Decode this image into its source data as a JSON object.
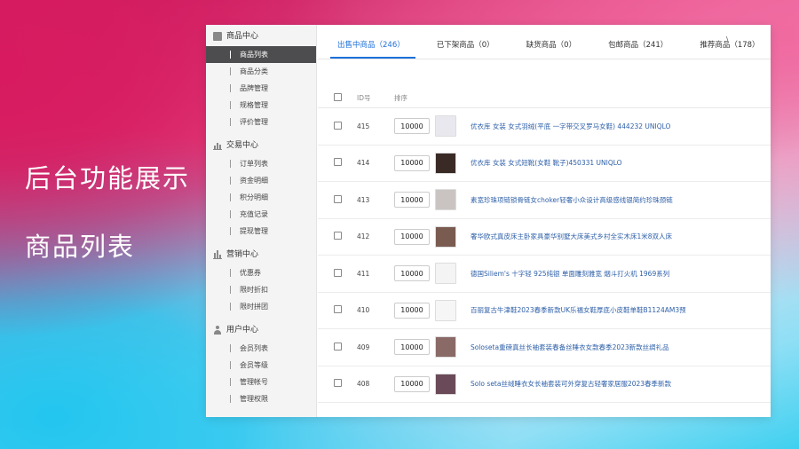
{
  "left_titles": [
    "后台功能展示",
    "商品列表"
  ],
  "sidebar": {
    "groups": [
      {
        "title": "商品中心",
        "icon": "box-icon",
        "items": [
          "商品列表",
          "商品分类",
          "品牌管理",
          "规格管理",
          "评价管理"
        ]
      },
      {
        "title": "交易中心",
        "icon": "bar-chart-icon",
        "items": [
          "订单列表",
          "资金明细",
          "积分明细",
          "充值记录",
          "提现管理"
        ]
      },
      {
        "title": "营销中心",
        "icon": "chart-icon",
        "items": [
          "优惠券",
          "限时折扣",
          "限时拼团"
        ]
      },
      {
        "title": "用户中心",
        "icon": "user-icon",
        "items": [
          "会员列表",
          "会员等级",
          "管理帐号",
          "管理权限"
        ]
      }
    ],
    "active_item": "商品列表"
  },
  "tabs": [
    {
      "label": "出售中商品（246）",
      "active": true
    },
    {
      "label": "已下架商品（0）",
      "active": false
    },
    {
      "label": "缺货商品（0）",
      "active": false
    },
    {
      "label": "包邮商品（241）",
      "active": false
    },
    {
      "label": "推荐商品（178）",
      "active": false
    }
  ],
  "table": {
    "headers": {
      "id": "ID号",
      "sort": "排序"
    },
    "rows": [
      {
        "id": "415",
        "sort": "10000",
        "name": "优衣库 女装 女式羽绒(平底 一字带交叉罗马女鞋) 444232 UNIQLO",
        "thumb_color": "#e8e8ee"
      },
      {
        "id": "414",
        "sort": "10000",
        "name": "优衣库 女装 女式短靴(女鞋 靴子)450331 UNIQLO",
        "thumb_color": "#3a2a26"
      },
      {
        "id": "413",
        "sort": "10000",
        "name": "素宽珍珠项链锁骨链女choker轻奢小众设计高级感线银简约珍珠颈链",
        "thumb_color": "#c9c4c2"
      },
      {
        "id": "412",
        "sort": "10000",
        "name": "奢华欧式真皮床主卧家具豪华别墅大床美式乡村全实木床1米8双人床",
        "thumb_color": "#7a5b50"
      },
      {
        "id": "411",
        "sort": "10000",
        "name": "德国Siliem's 十字轻 925纯银 单面雕刻雅宽 烟斗打火机 1969系列",
        "thumb_color": "#f4f4f4"
      },
      {
        "id": "410",
        "sort": "10000",
        "name": "百丽复古牛津鞋2023春季新款UK乐福女鞋厚底小皮鞋单鞋B1124AM3预",
        "thumb_color": "#f6f6f6"
      },
      {
        "id": "409",
        "sort": "10000",
        "name": "Soloseta重磅真丝长袖套装春备丝睡衣女款春季2023新款丝绸礼品",
        "thumb_color": "#8a6a66"
      },
      {
        "id": "408",
        "sort": "10000",
        "name": "Solo seta丝绒睡衣女长袖套装可外穿复古轻奢家居服2023春季新款",
        "thumb_color": "#6a4a58"
      }
    ]
  },
  "accent_color": "#1e6fd9"
}
